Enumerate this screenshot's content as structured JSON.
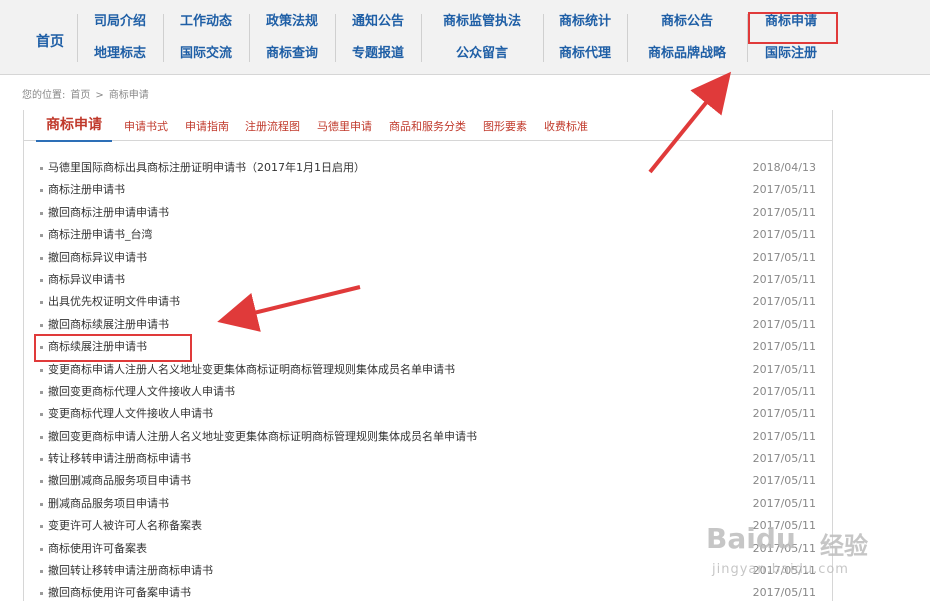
{
  "nav": {
    "home": "首页",
    "columns": [
      {
        "top": "司局介绍",
        "bottom": "地理标志"
      },
      {
        "top": "工作动态",
        "bottom": "国际交流"
      },
      {
        "top": "政策法规",
        "bottom": "商标查询"
      },
      {
        "top": "通知公告",
        "bottom": "专题报道"
      },
      {
        "top": "商标监管执法",
        "bottom": "公众留言"
      },
      {
        "top": "商标统计",
        "bottom": "商标代理"
      },
      {
        "top": "商标公告",
        "bottom": "商标品牌战略"
      },
      {
        "top": "商标申请",
        "bottom": "国际注册"
      }
    ]
  },
  "breadcrumb": {
    "prefix": "您的位置:",
    "home": "首页",
    "sep": ">",
    "current": "商标申请"
  },
  "tabs": {
    "active": "商标申请",
    "items": [
      "申请书式",
      "申请指南",
      "注册流程图",
      "马德里申请",
      "商品和服务分类",
      "图形要素",
      "收费标准"
    ]
  },
  "list": [
    {
      "title": "马德里国际商标出具商标注册证明申请书（2017年1月1日启用）",
      "date": "2018/04/13"
    },
    {
      "title": "商标注册申请书",
      "date": "2017/05/11"
    },
    {
      "title": "撤回商标注册申请申请书",
      "date": "2017/05/11"
    },
    {
      "title": "商标注册申请书_台湾",
      "date": "2017/05/11"
    },
    {
      "title": "撤回商标异议申请书",
      "date": "2017/05/11"
    },
    {
      "title": "商标异议申请书",
      "date": "2017/05/11"
    },
    {
      "title": "出具优先权证明文件申请书",
      "date": "2017/05/11"
    },
    {
      "title": "撤回商标续展注册申请书",
      "date": "2017/05/11"
    },
    {
      "title": "商标续展注册申请书",
      "date": "2017/05/11"
    },
    {
      "title": "变更商标申请人注册人名义地址变更集体商标证明商标管理规则集体成员名单申请书",
      "date": "2017/05/11"
    },
    {
      "title": "撤回变更商标代理人文件接收人申请书",
      "date": "2017/05/11"
    },
    {
      "title": "变更商标代理人文件接收人申请书",
      "date": "2017/05/11"
    },
    {
      "title": "撤回变更商标申请人注册人名义地址变更集体商标证明商标管理规则集体成员名单申请书",
      "date": "2017/05/11"
    },
    {
      "title": "转让移转申请注册商标申请书",
      "date": "2017/05/11"
    },
    {
      "title": "撤回删减商品服务项目申请书",
      "date": "2017/05/11"
    },
    {
      "title": "删减商品服务项目申请书",
      "date": "2017/05/11"
    },
    {
      "title": "变更许可人被许可人名称备案表",
      "date": "2017/05/11"
    },
    {
      "title": "商标使用许可备案表",
      "date": "2017/05/11"
    },
    {
      "title": "撤回转让移转申请注册商标申请书",
      "date": "2017/05/11"
    },
    {
      "title": "撤回商标使用许可备案申请书",
      "date": "2017/05/11"
    }
  ],
  "watermark": {
    "brand": "Baidu",
    "cn": "经验",
    "site": "jingyan.baidu.com"
  },
  "colors": {
    "nav_link": "#1f5fa6",
    "tab_red": "#c0392b",
    "highlight": "#e03a3a",
    "tab_underline": "#2d6fb7"
  }
}
